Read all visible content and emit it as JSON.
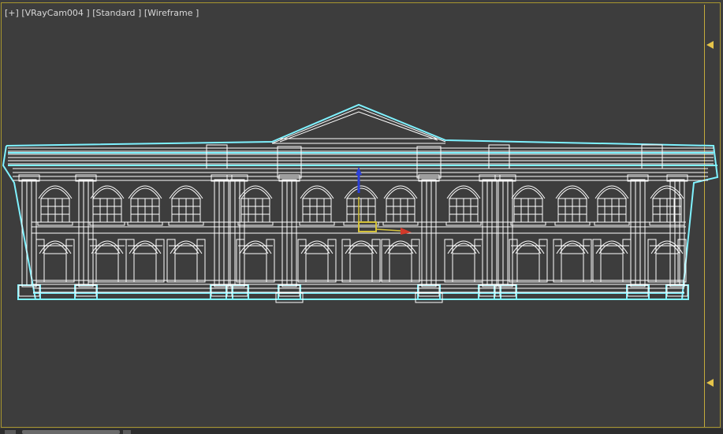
{
  "viewport": {
    "label_plus": "[+]",
    "label_camera": "[VRayCam004 ]",
    "label_shading": "[Standard ]",
    "label_mode": "[Wireframe ]"
  },
  "colors": {
    "background": "#3d3d3d",
    "wire_white": "#ffffff",
    "selection_cyan": "#7ff2ff",
    "safe_frame": "#c4ab3c",
    "gizmo_blue": "#2a3fd8",
    "gizmo_yellow": "#d4c23a",
    "gizmo_red": "#d23a2a"
  },
  "icons": {
    "safe_frame_marker": "triangle-left-icon",
    "transform_gizmo": "move-gizmo-icon"
  }
}
